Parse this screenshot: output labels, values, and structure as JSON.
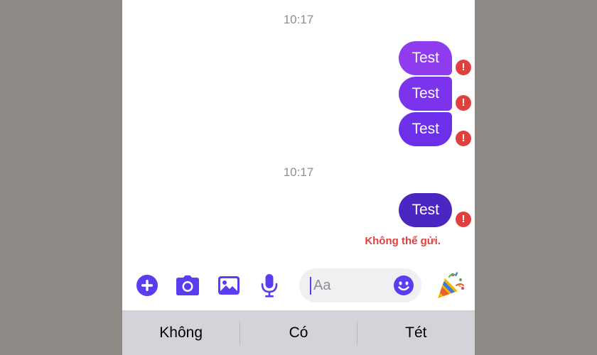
{
  "colors": {
    "bubble_gradient_light": "#7a2fe8",
    "bubble_dark": "#4a27c0",
    "error_red": "#e0403d",
    "accent_blue": "#5b3cf0",
    "timestamp_gray": "#8e8e93",
    "suggestion_bar": "#d3d4d9"
  },
  "thread": {
    "groups": [
      {
        "timestamp": "10:17",
        "messages": [
          "Test",
          "Test",
          "Test"
        ]
      },
      {
        "timestamp": "10:17",
        "messages": [
          "Test"
        ],
        "error_text": "Không thể gửi."
      }
    ]
  },
  "composer": {
    "placeholder": "Aa",
    "icons": [
      "plus-circle-icon",
      "camera-icon",
      "gallery-icon",
      "microphone-icon",
      "smiley-icon",
      "party-popper-icon"
    ]
  },
  "keyboard_suggestions": [
    "Không",
    "Có",
    "Tét"
  ]
}
